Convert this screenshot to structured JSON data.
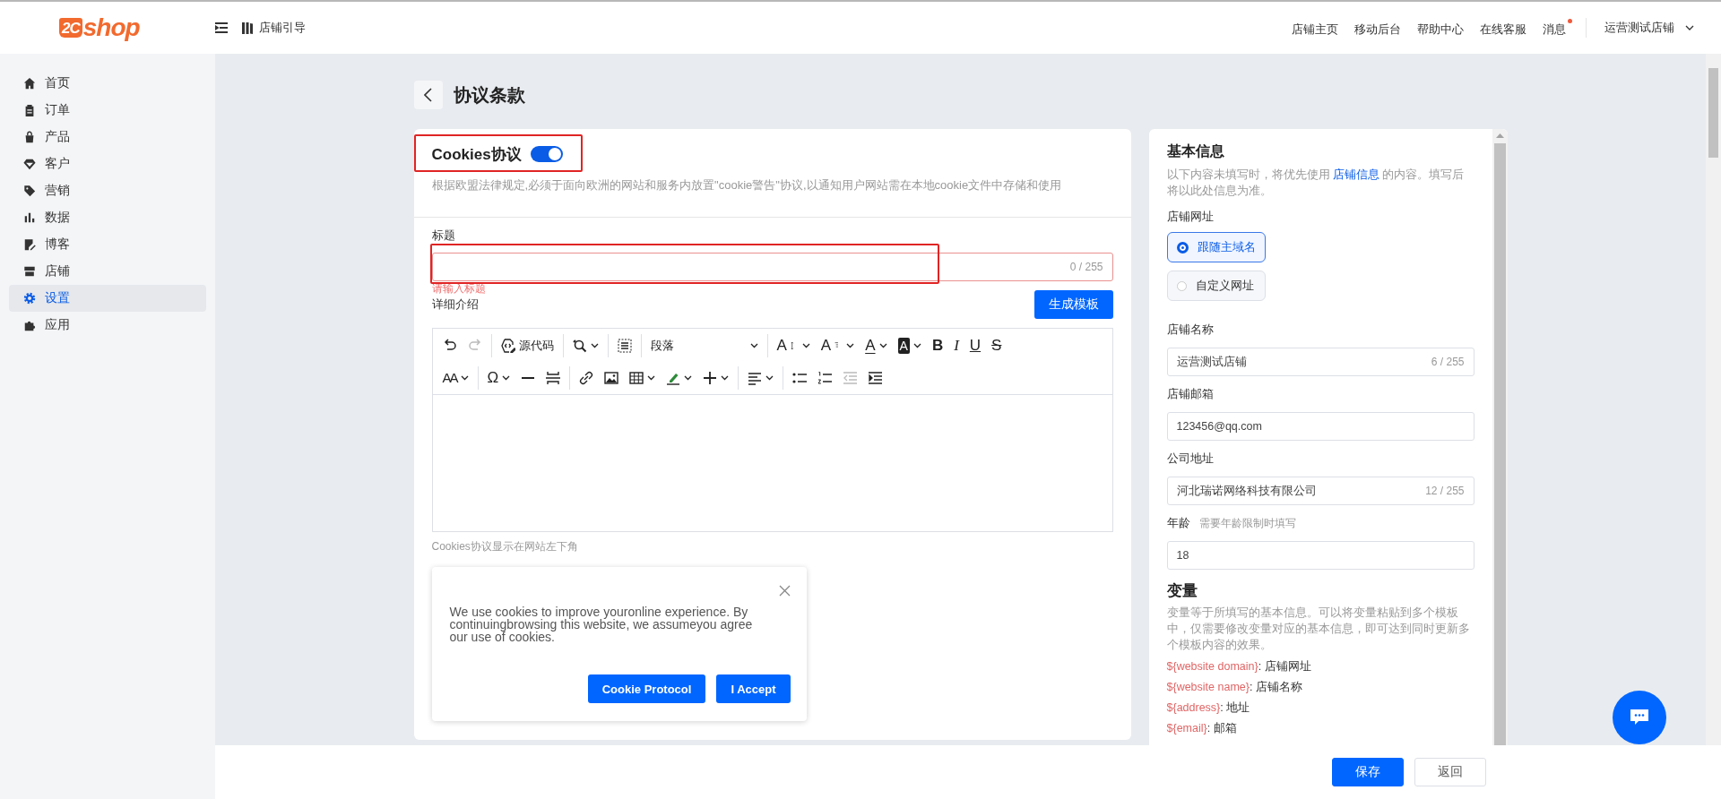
{
  "topbar": {
    "logo": {
      "mark": "2C",
      "text": "shop"
    },
    "guide": "店铺引导",
    "links": [
      {
        "label": "店铺主页",
        "unread": false
      },
      {
        "label": "移动后台",
        "unread": false
      },
      {
        "label": "帮助中心",
        "unread": false
      },
      {
        "label": "在线客服",
        "unread": false
      },
      {
        "label": "消息",
        "unread": true
      }
    ],
    "store": "运营测试店铺"
  },
  "sidebar": {
    "items": [
      {
        "label": "首页",
        "selected": false
      },
      {
        "label": "订单",
        "selected": false
      },
      {
        "label": "产品",
        "selected": false
      },
      {
        "label": "客户",
        "selected": false
      },
      {
        "label": "营销",
        "selected": false
      },
      {
        "label": "数据",
        "selected": false
      },
      {
        "label": "博客",
        "selected": false
      },
      {
        "label": "店铺",
        "selected": false
      },
      {
        "label": "设置",
        "selected": true
      },
      {
        "label": "应用",
        "selected": false
      }
    ]
  },
  "page": {
    "title": "协议条款"
  },
  "agreement": {
    "title": "Cookies协议",
    "highlighted": true,
    "on": true,
    "description": "根据欧盟法律规定,必须于面向欧洲的网站和服务内放置\"cookie警告\"协议,以通知用户网站需在本地cookie文件中存储和使用",
    "title_field": {
      "label": "标题",
      "counter": "0 / 255",
      "error": "请输入标题",
      "highlighted": true
    },
    "detail_label": "详细介绍",
    "generate_button": "生成模板",
    "toolbar": [
      [
        {
          "kind": "undo",
          "disabled": false
        },
        {
          "kind": "redo",
          "disabled": true
        },
        {
          "kind": "source",
          "label": "源代码",
          "sep": true,
          "disabled": false
        },
        {
          "kind": "find",
          "sep": true,
          "caret": true,
          "disabled": false
        },
        {
          "kind": "selectall",
          "sep": true,
          "disabled": false
        },
        {
          "kind": "block",
          "label": "段落",
          "sep": true,
          "caret": true,
          "disabled": false
        },
        {
          "kind": "fontsize",
          "glyph": "A",
          "sep": true,
          "caret": true,
          "disabled": false
        },
        {
          "kind": "lineheight",
          "glyph": "A",
          "caret": true,
          "disabled": false
        },
        {
          "kind": "forecolor",
          "glyph": "A",
          "caret": true,
          "disabled": false
        },
        {
          "kind": "backcolor",
          "glyph": "A",
          "caret": true,
          "disabled": false
        },
        {
          "kind": "bold",
          "glyph": "B",
          "disabled": false
        },
        {
          "kind": "italic",
          "glyph": "I",
          "disabled": false
        },
        {
          "kind": "underline",
          "glyph": "U",
          "disabled": false
        },
        {
          "kind": "strike",
          "glyph": "S",
          "disabled": false
        }
      ],
      [
        {
          "kind": "fontfamily",
          "glyph": "AA",
          "caret": true,
          "disabled": false
        },
        {
          "kind": "charmap",
          "glyph": "Ω",
          "sep": true,
          "caret": true,
          "disabled": false
        },
        {
          "kind": "hr",
          "disabled": false
        },
        {
          "kind": "pagebreak",
          "disabled": false
        },
        {
          "kind": "link",
          "sep": true,
          "disabled": false
        },
        {
          "kind": "image",
          "disabled": false
        },
        {
          "kind": "table",
          "caret": true,
          "disabled": false
        },
        {
          "kind": "highlight",
          "caret": true,
          "disabled": false
        },
        {
          "kind": "insert",
          "caret": true,
          "disabled": false
        },
        {
          "kind": "align",
          "sep": true,
          "caret": true,
          "disabled": false
        },
        {
          "kind": "bullist",
          "sep": true,
          "disabled": false
        },
        {
          "kind": "numlist",
          "disabled": false
        },
        {
          "kind": "outdent",
          "disabled": true
        },
        {
          "kind": "indent",
          "disabled": false
        }
      ]
    ],
    "hint": "Cookies协议显示在网站左下角",
    "preview": {
      "text": "We use cookies to improve youronline experience. By continuingbrowsing this website, we assumeyou agree our use of cookies.",
      "buttons": [
        "Cookie Protocol",
        "I Accept"
      ]
    }
  },
  "info": {
    "title": "基本信息",
    "description_before": "以下内容未填写时，将优先使用 ",
    "link": "店铺信息",
    "description_after": " 的内容。填写后将以此处信息为准。",
    "url": {
      "label": "店铺网址",
      "options": [
        {
          "label": "跟随主域名",
          "selected": true
        },
        {
          "label": "自定义网址",
          "selected": false
        }
      ]
    },
    "fields": [
      {
        "label": "店铺名称",
        "value": "运营测试店铺",
        "counter": "6 / 255"
      },
      {
        "label": "店铺邮箱",
        "value": "123456@qq.com"
      },
      {
        "label": "公司地址",
        "value": "河北瑞诺网络科技有限公司",
        "counter": "12 / 255"
      },
      {
        "label": "年龄",
        "note": "需要年龄限制时填写",
        "value": "18"
      }
    ],
    "variables": {
      "title": "变量",
      "description": "变量等于所填写的基本信息。可以将变量粘贴到多个模板中，仅需要修改变量对应的基本信息，即可达到同时更新多个模板内容的效果。",
      "items": [
        {
          "name": "${website domain}",
          "meaning": ": 店铺网址"
        },
        {
          "name": "${website name}",
          "meaning": ": 店铺名称"
        },
        {
          "name": "${address}",
          "meaning": ": 地址"
        },
        {
          "name": "${email}",
          "meaning": ": 邮箱"
        }
      ]
    }
  },
  "footer": {
    "buttons": [
      {
        "label": "保存",
        "kind": "primary"
      },
      {
        "label": "返回",
        "kind": "default"
      }
    ]
  }
}
